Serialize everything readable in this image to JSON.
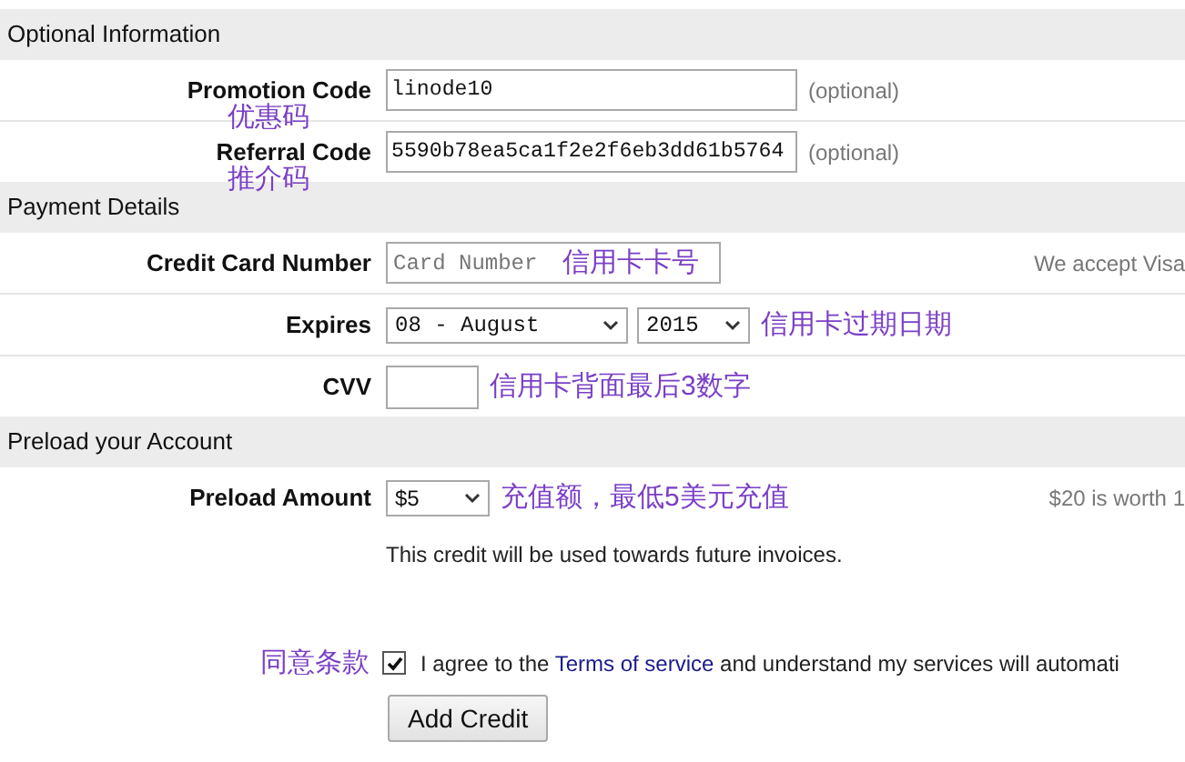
{
  "sections": [
    {
      "title": "Optional Information",
      "rows": [
        {
          "kind": "text",
          "label": "Promotion Code",
          "value": "linode10",
          "note": "(optional)",
          "annotation_below": "优惠码"
        },
        {
          "kind": "text",
          "label": "Referral Code",
          "value": "5590b78ea5ca1f2e2f6eb3dd61b5764",
          "note": "(optional)",
          "annotation_below": "推介码"
        }
      ]
    },
    {
      "title": "Payment Details",
      "rows": [
        {
          "kind": "card",
          "label": "Credit Card Number",
          "placeholder": "Card Number",
          "annotation": "信用卡卡号",
          "side_note": "We accept Visa"
        },
        {
          "kind": "selects",
          "label": "Expires",
          "selects": [
            "08 - August",
            "2015"
          ],
          "annotation": "信用卡过期日期"
        },
        {
          "kind": "short",
          "label": "CVV",
          "annotation": "信用卡背面最后3数字"
        }
      ]
    },
    {
      "title": "Preload your Account",
      "rows": [
        {
          "kind": "amount",
          "label": "Preload Amount",
          "selects": [
            "$5"
          ],
          "annotation": "充值额，最低5美元充值",
          "side_note": "$20 is worth 1"
        }
      ]
    }
  ],
  "description": "This credit will be used towards future invoices.",
  "agreement": {
    "annotation": "同意条款",
    "checked": true,
    "text_before": "I agree to the",
    "link": "Terms of service",
    "text_after": "and understand my services will automati"
  },
  "submit": "Add Credit"
}
